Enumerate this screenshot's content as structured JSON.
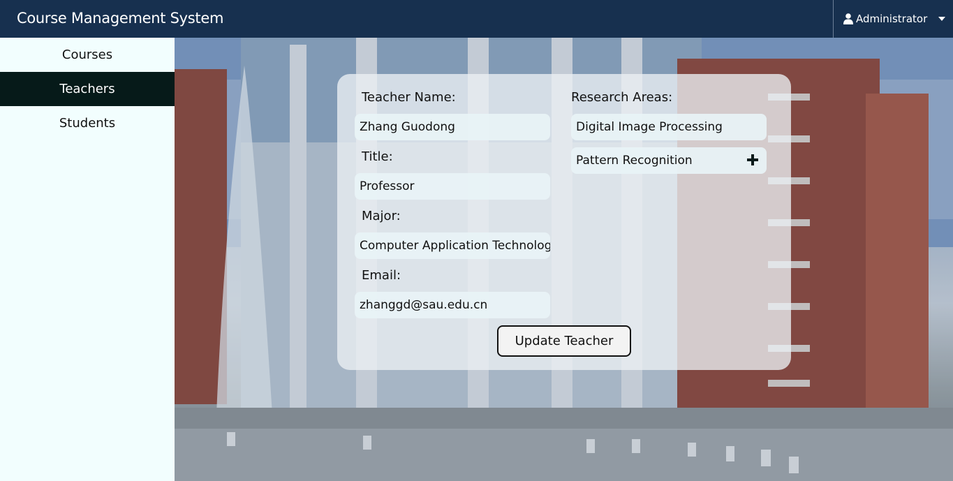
{
  "navbar": {
    "title": "Course Management System",
    "user_label": "Administrator",
    "user_icon": "user-icon"
  },
  "sidebar": {
    "items": [
      {
        "label": "Courses",
        "active": false
      },
      {
        "label": "Teachers",
        "active": true
      },
      {
        "label": "Students",
        "active": false
      }
    ]
  },
  "form": {
    "teacher_name": {
      "label": "Teacher Name:",
      "value": "Zhang Guodong"
    },
    "title": {
      "label": "Title:",
      "value": "Professor"
    },
    "major": {
      "label": "Major:",
      "value": "Computer Application Technology"
    },
    "email": {
      "label": "Email:",
      "value": "zhanggd@sau.edu.cn"
    },
    "research": {
      "label": "Research Areas:",
      "areas": [
        "Digital Image Processing",
        "Pattern Recognition"
      ],
      "add_icon": "plus-icon"
    },
    "submit_label": "Update Teacher"
  },
  "colors": {
    "navbar_bg": "#17304f",
    "sidebar_bg": "#f2fefe",
    "sidebar_active_bg": "#061a19"
  }
}
